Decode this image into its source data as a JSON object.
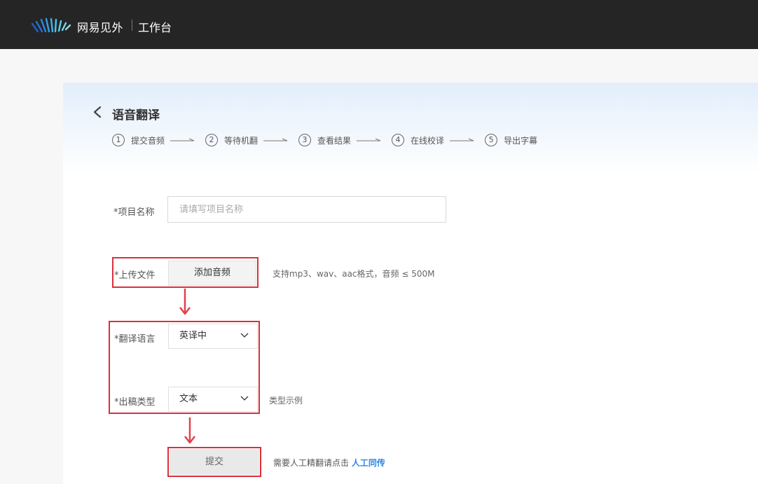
{
  "header": {
    "brand": "网易见外",
    "sub": "工作台",
    "logo_icon": "waves-logo-icon"
  },
  "page": {
    "title": "语音翻译",
    "steps": [
      {
        "num": "1",
        "label": "提交音频"
      },
      {
        "num": "2",
        "label": "等待机翻"
      },
      {
        "num": "3",
        "label": "查看结果"
      },
      {
        "num": "4",
        "label": "在线校译"
      },
      {
        "num": "5",
        "label": "导出字幕"
      }
    ]
  },
  "form": {
    "project_name_label": "*项目名称",
    "project_name_placeholder": "请填写项目名称",
    "project_name_value": "",
    "upload_label": "*上传文件",
    "upload_button": "添加音频",
    "upload_hint": "支持mp3、wav、aac格式，音频 ≤ 500M",
    "language_label": "*翻译语言",
    "language_value": "英译中",
    "output_label": "*出稿类型",
    "output_value": "文本",
    "output_hint": "类型示例",
    "submit_button": "提交",
    "submit_hint": "需要人工精翻请点击",
    "submit_link": "人工同传"
  },
  "colors": {
    "topbar": "#252525",
    "accent": "#2f86e6",
    "highlight": "#d9313b"
  }
}
